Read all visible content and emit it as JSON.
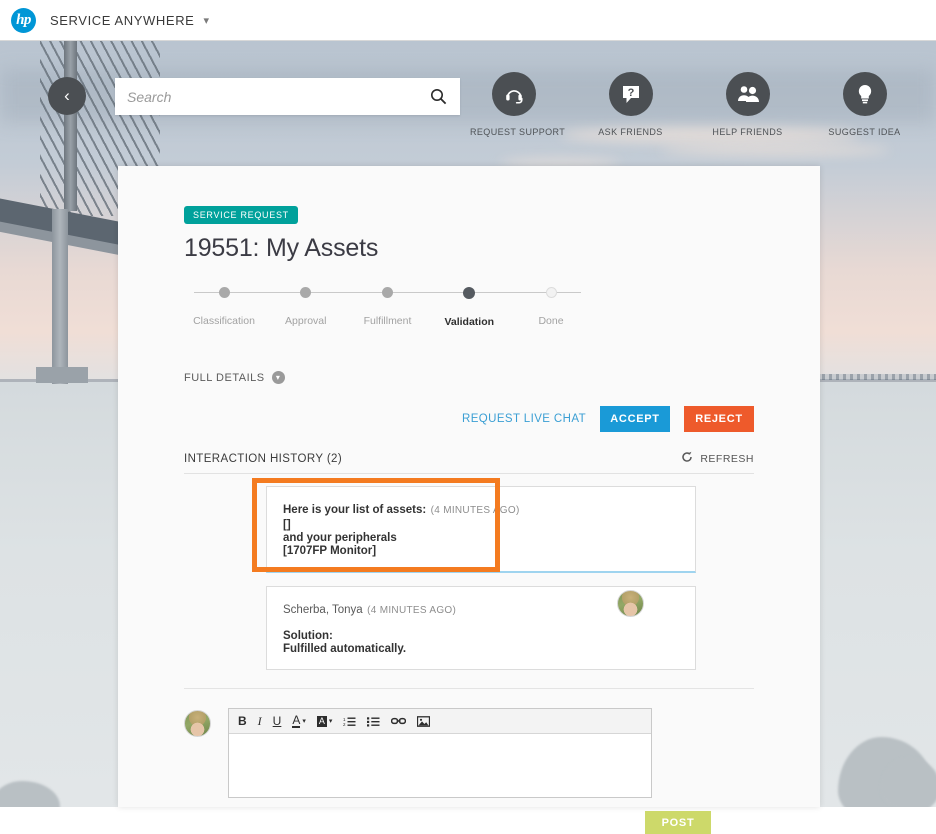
{
  "topbar": {
    "logo_text": "hp",
    "logo_icon": "hp-logo-icon",
    "brand": "SERVICE ANYWHERE",
    "caret_icon": "chevron-down-icon",
    "brand_color": "#0096d6"
  },
  "collapse": {
    "icon": "chevron-left-icon",
    "glyph": "‹"
  },
  "search": {
    "value": "",
    "placeholder": "Search",
    "icon": "search-icon"
  },
  "actions": [
    {
      "label": "REQUEST SUPPORT",
      "icon": "headset-icon"
    },
    {
      "label": "ASK FRIENDS",
      "icon": "question-bubble-icon"
    },
    {
      "label": "HELP FRIENDS",
      "icon": "people-icon"
    },
    {
      "label": "SUGGEST IDEA",
      "icon": "lightbulb-icon"
    }
  ],
  "request": {
    "badge": "SERVICE REQUEST",
    "badge_color": "#00a19b",
    "title": "19551: My Assets",
    "steps": [
      {
        "label": "Classification",
        "state": "done"
      },
      {
        "label": "Approval",
        "state": "done"
      },
      {
        "label": "Fulfillment",
        "state": "done"
      },
      {
        "label": "Validation",
        "state": "active"
      },
      {
        "label": "Done",
        "state": "pending"
      }
    ],
    "full_details_label": "FULL DETAILS",
    "full_details_icon": "chevron-down-circle-icon"
  },
  "action_row": {
    "live_chat_label": "REQUEST LIVE CHAT",
    "accept_label": "ACCEPT",
    "reject_label": "REJECT",
    "accept_color": "#1a9ad7",
    "reject_color": "#ee5a2b"
  },
  "history": {
    "title": "INTERACTION HISTORY (2)",
    "refresh_label": "REFRESH",
    "refresh_icon": "refresh-icon",
    "highlight_color": "#f47b20",
    "messages": [
      {
        "heading": "Here is your list of assets:",
        "time": "(4 MINUTES AGO)",
        "lines": [
          "[]",
          "and your peripherals",
          "[1707FP Monitor]"
        ],
        "highlighted": true
      },
      {
        "author": "Scherba, Tonya",
        "time": "(4 MINUTES AGO)",
        "lines": [
          "Solution:",
          "Fulfilled automatically."
        ],
        "avatar": "user-avatar",
        "highlighted": false
      }
    ]
  },
  "composer": {
    "avatar": "user-avatar",
    "value": "",
    "toolbar": [
      {
        "name": "bold-icon",
        "glyph": "B"
      },
      {
        "name": "italic-icon",
        "glyph": "I"
      },
      {
        "name": "underline-icon",
        "glyph": "U"
      },
      {
        "name": "text-color-icon",
        "glyph": "A"
      },
      {
        "name": "highlight-color-icon",
        "glyph": "A"
      },
      {
        "name": "numbered-list-icon",
        "glyph": ""
      },
      {
        "name": "bulleted-list-icon",
        "glyph": ""
      },
      {
        "name": "link-icon",
        "glyph": ""
      },
      {
        "name": "image-icon",
        "glyph": ""
      }
    ],
    "post_label": "POST",
    "post_color": "#cdd96a"
  }
}
